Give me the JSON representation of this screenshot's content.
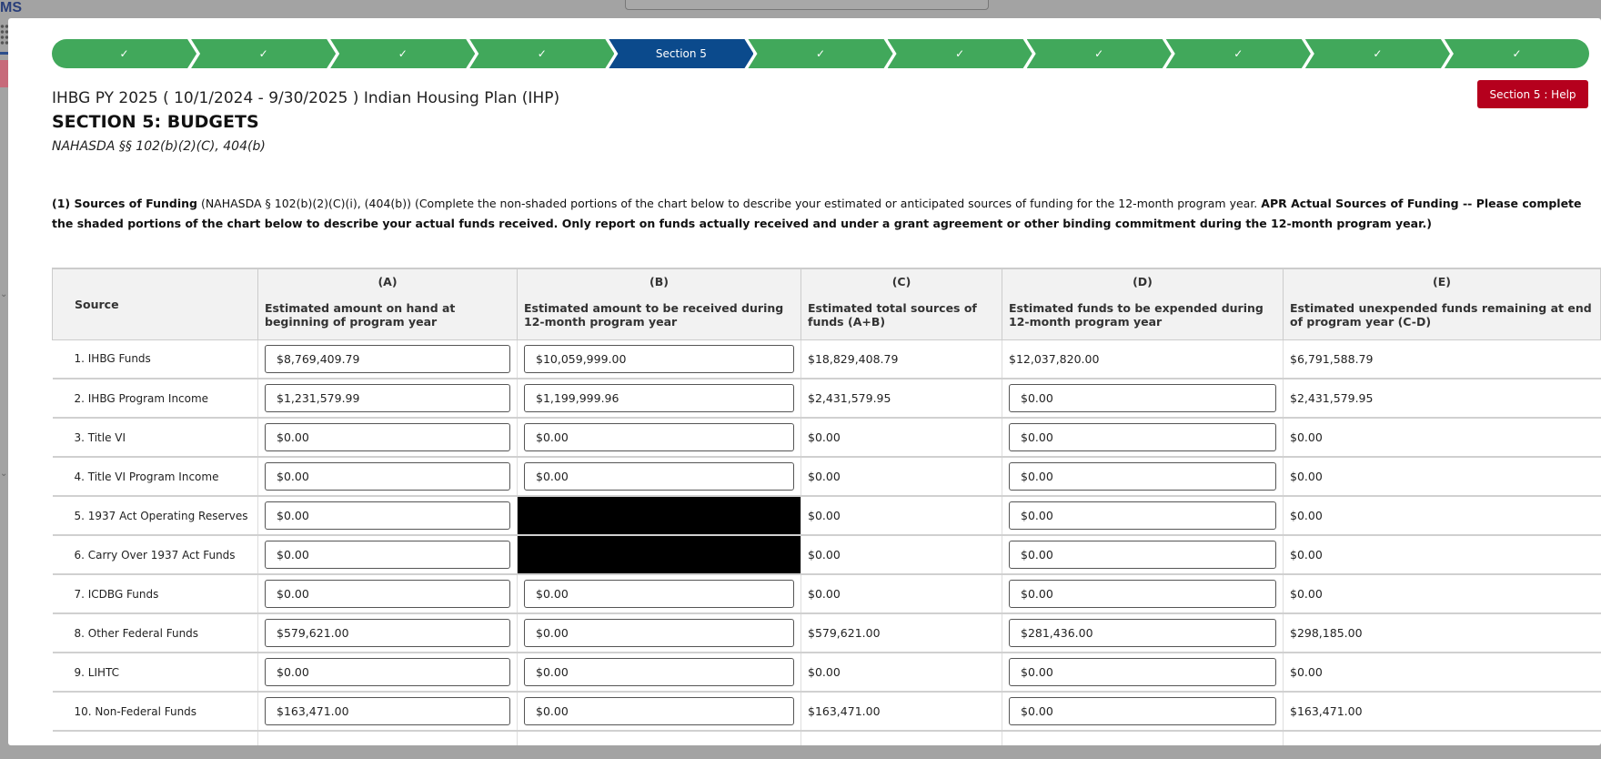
{
  "app": {
    "logo_text": "MS"
  },
  "stepper": {
    "steps": [
      {
        "label": "✓",
        "status": "complete"
      },
      {
        "label": "✓",
        "status": "complete"
      },
      {
        "label": "✓",
        "status": "complete"
      },
      {
        "label": "✓",
        "status": "complete"
      },
      {
        "label": "Section 5",
        "status": "active"
      },
      {
        "label": "✓",
        "status": "complete"
      },
      {
        "label": "✓",
        "status": "complete"
      },
      {
        "label": "✓",
        "status": "complete"
      },
      {
        "label": "✓",
        "status": "complete"
      },
      {
        "label": "✓",
        "status": "complete"
      },
      {
        "label": "✓",
        "status": "complete"
      }
    ],
    "colors": {
      "complete": "#41a85b",
      "active": "#0b4a8c"
    }
  },
  "header": {
    "title": "IHBG PY 2025 ( 10/1/2024 - 9/30/2025 ) Indian Housing Plan (IHP)",
    "heading": "SECTION 5: BUDGETS",
    "citation": "NAHASDA §§ 102(b)(2)(C), 404(b)",
    "help_button": "Section 5 : Help"
  },
  "intro": {
    "label": "(1) Sources of Funding",
    "text": " (NAHASDA § 102(b)(2)(C)(i), (404(b)) (Complete the non-shaded portions of the chart below to describe your estimated or anticipated sources of funding for the 12-month program year. ",
    "bold_text": "APR Actual Sources of Funding -- Please complete the shaded portions of the chart below to describe your actual funds received. Only report on funds actually received and under a grant agreement or other binding commitment during the 12-month program year.)"
  },
  "table": {
    "columns": [
      {
        "letter": "",
        "label": "Source"
      },
      {
        "letter": "(A)",
        "label": "Estimated amount on hand at beginning of program year"
      },
      {
        "letter": "(B)",
        "label": "Estimated amount to be received during 12-month program year"
      },
      {
        "letter": "(C)",
        "label": "Estimated total sources of funds (A+B)"
      },
      {
        "letter": "(D)",
        "label": "Estimated funds to be expended during 12-month program year"
      },
      {
        "letter": "(E)",
        "label": "Estimated unexpended funds remaining at end of program year (C-D)"
      }
    ],
    "rows": [
      {
        "source": "1. IHBG Funds",
        "a": "$8,769,409.79",
        "b": "$10,059,999.00",
        "c": "$18,829,408.79",
        "d": "$12,037,820.00",
        "d_input": false,
        "e": "$6,791,588.79"
      },
      {
        "source": "2. IHBG Program Income",
        "a": "$1,231,579.99",
        "b": "$1,199,999.96",
        "c": "$2,431,579.95",
        "d": "$0.00",
        "d_input": true,
        "e": "$2,431,579.95"
      },
      {
        "source": "3. Title VI",
        "a": "$0.00",
        "b": "$0.00",
        "c": "$0.00",
        "d": "$0.00",
        "d_input": true,
        "e": "$0.00"
      },
      {
        "source": "4. Title VI Program Income",
        "a": "$0.00",
        "b": "$0.00",
        "c": "$0.00",
        "d": "$0.00",
        "d_input": true,
        "e": "$0.00"
      },
      {
        "source": "5. 1937 Act Operating Reserves",
        "a": "$0.00",
        "b": null,
        "c": "$0.00",
        "d": "$0.00",
        "d_input": true,
        "e": "$0.00"
      },
      {
        "source": "6. Carry Over 1937 Act Funds",
        "a": "$0.00",
        "b": null,
        "c": "$0.00",
        "d": "$0.00",
        "d_input": true,
        "e": "$0.00"
      },
      {
        "source": "7. ICDBG Funds",
        "a": "$0.00",
        "b": "$0.00",
        "c": "$0.00",
        "d": "$0.00",
        "d_input": true,
        "e": "$0.00"
      },
      {
        "source": "8. Other Federal Funds",
        "a": "$579,621.00",
        "b": "$0.00",
        "c": "$579,621.00",
        "d": "$281,436.00",
        "d_input": true,
        "e": "$298,185.00"
      },
      {
        "source": "9. LIHTC",
        "a": "$0.00",
        "b": "$0.00",
        "c": "$0.00",
        "d": "$0.00",
        "d_input": true,
        "e": "$0.00"
      },
      {
        "source": "10. Non-Federal Funds",
        "a": "$163,471.00",
        "b": "$0.00",
        "c": "$163,471.00",
        "d": "$0.00",
        "d_input": true,
        "e": "$163,471.00"
      }
    ]
  }
}
